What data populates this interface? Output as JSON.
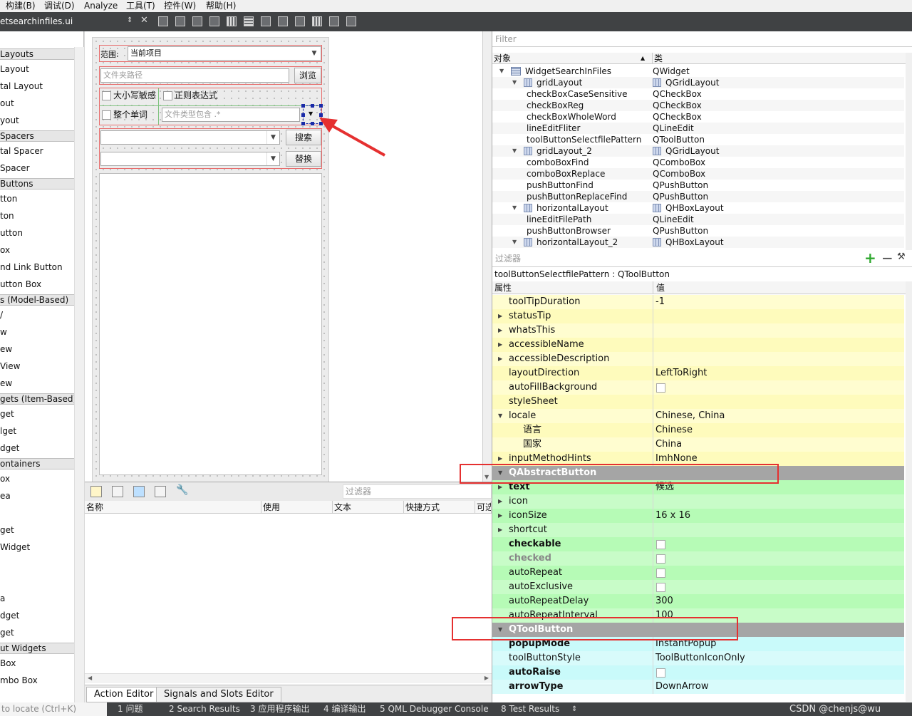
{
  "menubar": {
    "items": [
      "构建(B)",
      "调试(D)",
      "Analyze",
      "工具(T)",
      "控件(W)",
      "帮助(H)"
    ]
  },
  "toolbar": {
    "file_name": "etsearchinfiles.ui"
  },
  "widget_box": {
    "entries": [
      {
        "kind": "cat",
        "label": "Layouts"
      },
      {
        "kind": "item",
        "label": "Layout"
      },
      {
        "kind": "item",
        "label": "tal Layout"
      },
      {
        "kind": "item",
        "label": "out"
      },
      {
        "kind": "item",
        "label": "yout"
      },
      {
        "kind": "cat",
        "label": "Spacers"
      },
      {
        "kind": "item",
        "label": "tal Spacer"
      },
      {
        "kind": "item",
        "label": "Spacer"
      },
      {
        "kind": "cat",
        "label": "Buttons"
      },
      {
        "kind": "item",
        "label": "tton"
      },
      {
        "kind": "item",
        "label": "ton"
      },
      {
        "kind": "item",
        "label": "utton"
      },
      {
        "kind": "item",
        "label": "ox"
      },
      {
        "kind": "item",
        "label": "nd Link Button"
      },
      {
        "kind": "item",
        "label": "utton Box"
      },
      {
        "kind": "cat",
        "label": "s (Model-Based)"
      },
      {
        "kind": "item",
        "label": "/"
      },
      {
        "kind": "item",
        "label": "w"
      },
      {
        "kind": "item",
        "label": "ew"
      },
      {
        "kind": "item",
        "label": "View"
      },
      {
        "kind": "item",
        "label": "ew"
      },
      {
        "kind": "cat",
        "label": "gets (Item-Based)"
      },
      {
        "kind": "item",
        "label": "get"
      },
      {
        "kind": "item",
        "label": "lget"
      },
      {
        "kind": "item",
        "label": "dget"
      },
      {
        "kind": "cat",
        "label": "ontainers"
      },
      {
        "kind": "item",
        "label": "ox"
      },
      {
        "kind": "item",
        "label": "ea"
      },
      {
        "kind": "item",
        "label": ""
      },
      {
        "kind": "item",
        "label": "get"
      },
      {
        "kind": "item",
        "label": "Widget"
      },
      {
        "kind": "item",
        "label": ""
      },
      {
        "kind": "item",
        "label": ""
      },
      {
        "kind": "item",
        "label": "a"
      },
      {
        "kind": "item",
        "label": "dget"
      },
      {
        "kind": "item",
        "label": "get"
      },
      {
        "kind": "cat",
        "label": "ut Widgets"
      },
      {
        "kind": "item",
        "label": "Box"
      },
      {
        "kind": "item",
        "label": "mbo Box"
      }
    ]
  },
  "form": {
    "scope_label": "范围:",
    "scope_value": "当前项目",
    "path_placeholder": "文件夹路径",
    "browse_button": "浏览",
    "case_sensitive": "大小写敏感",
    "regex": "正则表达式",
    "whole_word": "整个单词",
    "file_pattern_placeholder": "文件类型包含  .*",
    "search_button": "搜索",
    "replace_button": "替换"
  },
  "action_editor": {
    "filter_placeholder": "过滤器",
    "columns": [
      "名称",
      "使用",
      "文本",
      "快捷方式",
      "可选"
    ],
    "tabs": [
      "Action Editor",
      "Signals and Slots Editor"
    ]
  },
  "object_inspector": {
    "filter_placeholder": "Filter",
    "columns": [
      "对象",
      "类"
    ],
    "rows": [
      {
        "level": 0,
        "expand": true,
        "icon": "window",
        "object": "WidgetSearchInFiles",
        "class": "QWidget"
      },
      {
        "level": 1,
        "expand": true,
        "icon": "grid",
        "object": "gridLayout",
        "class": "QGridLayout"
      },
      {
        "level": 2,
        "expand": false,
        "icon": "",
        "object": "checkBoxCaseSensitive",
        "class": "QCheckBox"
      },
      {
        "level": 2,
        "expand": false,
        "icon": "",
        "object": "checkBoxReg",
        "class": "QCheckBox"
      },
      {
        "level": 2,
        "expand": false,
        "icon": "",
        "object": "checkBoxWholeWord",
        "class": "QCheckBox"
      },
      {
        "level": 2,
        "expand": false,
        "icon": "",
        "object": "lineEditFliter",
        "class": "QLineEdit"
      },
      {
        "level": 2,
        "expand": false,
        "icon": "",
        "object": "toolButtonSelectfilePattern",
        "class": "QToolButton"
      },
      {
        "level": 1,
        "expand": true,
        "icon": "grid",
        "object": "gridLayout_2",
        "class": "QGridLayout"
      },
      {
        "level": 2,
        "expand": false,
        "icon": "",
        "object": "comboBoxFind",
        "class": "QComboBox"
      },
      {
        "level": 2,
        "expand": false,
        "icon": "",
        "object": "comboBoxReplace",
        "class": "QComboBox"
      },
      {
        "level": 2,
        "expand": false,
        "icon": "",
        "object": "pushButtonFind",
        "class": "QPushButton"
      },
      {
        "level": 2,
        "expand": false,
        "icon": "",
        "object": "pushButtonReplaceFind",
        "class": "QPushButton"
      },
      {
        "level": 1,
        "expand": true,
        "icon": "hbox",
        "object": "horizontalLayout",
        "class": "QHBoxLayout"
      },
      {
        "level": 2,
        "expand": false,
        "icon": "",
        "object": "lineEditFilePath",
        "class": "QLineEdit"
      },
      {
        "level": 2,
        "expand": false,
        "icon": "",
        "object": "pushButtonBrowser",
        "class": "QPushButton"
      },
      {
        "level": 1,
        "expand": true,
        "icon": "hbox",
        "object": "horizontalLayout_2",
        "class": "QHBoxLayout"
      }
    ]
  },
  "property_editor": {
    "filter_placeholder": "过滤器",
    "selected_object": "toolButtonSelectfilePattern : QToolButton",
    "columns": [
      "属性",
      "值"
    ],
    "rows": [
      {
        "style": "y",
        "arrow": false,
        "name": "toolTipDuration",
        "value": "-1"
      },
      {
        "style": "y2",
        "arrow": true,
        "name": "statusTip",
        "value": ""
      },
      {
        "style": "y",
        "arrow": true,
        "name": "whatsThis",
        "value": ""
      },
      {
        "style": "y2",
        "arrow": true,
        "name": "accessibleName",
        "value": ""
      },
      {
        "style": "y",
        "arrow": true,
        "name": "accessibleDescription",
        "value": ""
      },
      {
        "style": "y2",
        "arrow": false,
        "name": "layoutDirection",
        "value": "LeftToRight"
      },
      {
        "style": "y",
        "arrow": false,
        "name": "autoFillBackground",
        "value": "",
        "check": true
      },
      {
        "style": "y2",
        "arrow": false,
        "name": "styleSheet",
        "value": ""
      },
      {
        "style": "y",
        "arrow": true,
        "name": "locale",
        "value": "Chinese, China",
        "open": true
      },
      {
        "style": "y2",
        "arrow": false,
        "name": "语言",
        "value": "Chinese",
        "indent": true
      },
      {
        "style": "y",
        "arrow": false,
        "name": "国家",
        "value": "China",
        "indent": true
      },
      {
        "style": "y2",
        "arrow": true,
        "name": "inputMethodHints",
        "value": "ImhNone"
      },
      {
        "style": "cat",
        "arrow": true,
        "name": "QAbstractButton",
        "value": "",
        "open": true
      },
      {
        "style": "g",
        "arrow": true,
        "name": "text",
        "value": "候选",
        "bold": true
      },
      {
        "style": "g2",
        "arrow": true,
        "name": "icon",
        "value": ""
      },
      {
        "style": "g",
        "arrow": true,
        "name": "iconSize",
        "value": "16 x 16"
      },
      {
        "style": "g2",
        "arrow": true,
        "name": "shortcut",
        "value": ""
      },
      {
        "style": "g",
        "arrow": false,
        "name": "checkable",
        "value": "",
        "check": true,
        "bold": true
      },
      {
        "style": "g2",
        "arrow": false,
        "name": "checked",
        "value": "",
        "check": true,
        "bold": true,
        "muted": true
      },
      {
        "style": "g",
        "arrow": false,
        "name": "autoRepeat",
        "value": "",
        "check": true
      },
      {
        "style": "g2",
        "arrow": false,
        "name": "autoExclusive",
        "value": "",
        "check": true
      },
      {
        "style": "g",
        "arrow": false,
        "name": "autoRepeatDelay",
        "value": "300"
      },
      {
        "style": "g2",
        "arrow": false,
        "name": "autoRepeatInterval",
        "value": "100"
      },
      {
        "style": "cat",
        "arrow": true,
        "name": "QToolButton",
        "value": "",
        "open": true
      },
      {
        "style": "c",
        "arrow": false,
        "name": "popupMode",
        "value": "InstantPopup",
        "bold": true
      },
      {
        "style": "c2",
        "arrow": false,
        "name": "toolButtonStyle",
        "value": "ToolButtonIconOnly"
      },
      {
        "style": "c",
        "arrow": false,
        "name": "autoRaise",
        "value": "",
        "check": true,
        "bold": true
      },
      {
        "style": "c2",
        "arrow": false,
        "name": "arrowType",
        "value": "DownArrow",
        "bold": true
      }
    ]
  },
  "statusbar": {
    "locate_placeholder": "to locate (Ctrl+K)",
    "issues_label": "1 问题",
    "issues_count": "1",
    "tabs": [
      "2 Search Results",
      "3 应用程序输出",
      "4 编译输出",
      "5 QML Debugger Console",
      "8 Test Results"
    ],
    "watermark": "CSDN @chenjs@wu"
  },
  "colors": {
    "annotation": "#e53030",
    "selection_handle": "#1a2aa8"
  }
}
